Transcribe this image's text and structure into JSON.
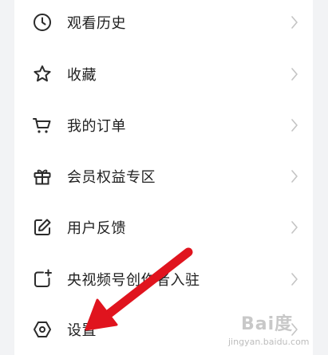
{
  "menu": {
    "items": [
      {
        "label": "观看历史",
        "icon": "clock-icon"
      },
      {
        "label": "收藏",
        "icon": "star-icon"
      },
      {
        "label": "我的订单",
        "icon": "cart-icon"
      },
      {
        "label": "会员权益专区",
        "icon": "gift-icon"
      },
      {
        "label": "用户反馈",
        "icon": "edit-icon"
      },
      {
        "label": "央视频号创作者入驻",
        "icon": "creator-add-icon"
      },
      {
        "label": "设置",
        "icon": "hexagon-settings-icon"
      }
    ]
  },
  "watermark": {
    "brand": "Bai度",
    "url": "jingyan.baidu.com"
  },
  "colors": {
    "background": "#f2f3f5",
    "card": "#ffffff",
    "text": "#1f1f1f",
    "icon": "#2b2b2b",
    "chevron": "#c4c4c4",
    "arrow": "#e0141e"
  }
}
